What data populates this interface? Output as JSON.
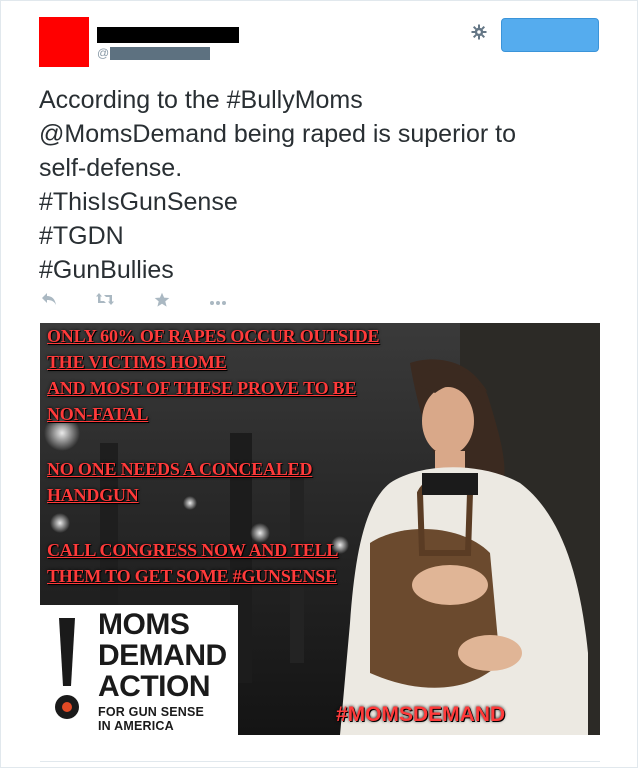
{
  "tweet": {
    "handle_prefix": "@",
    "text_lines": [
      "According to the #BullyMoms",
      "@MomsDemand being raped is superior to",
      "self-defense.",
      "#ThisIsGunSense",
      "#TGDN",
      "#GunBullies"
    ]
  },
  "icons": {
    "settings": "gear-icon",
    "reply": "reply-icon",
    "retweet": "retweet-icon",
    "favorite": "star-icon",
    "more": "more-icon"
  },
  "colors": {
    "avatar": "#ff0000",
    "follow_button": "#55acee",
    "overlay_text": "#ff3a3a",
    "logo_dot": "#e24a25"
  },
  "media": {
    "overlay_lines": [
      "ONLY 60% OF RAPES OCCUR OUTSIDE",
      "THE VICTIMS HOME",
      "AND MOST OF THESE PROVE TO BE",
      "NON-FATAL",
      "NO ONE NEEDS A CONCEALED",
      "HANDGUN",
      "CALL CONGRESS NOW AND TELL",
      "THEM TO GET SOME #GUNSENSE"
    ],
    "logo": {
      "line1": "MOMS",
      "line2": "DEMAND",
      "line3": "ACTION",
      "sub1": "FOR GUN SENSE",
      "sub2": "IN AMERICA"
    },
    "hashtag": "#MOMSDEMAND"
  }
}
